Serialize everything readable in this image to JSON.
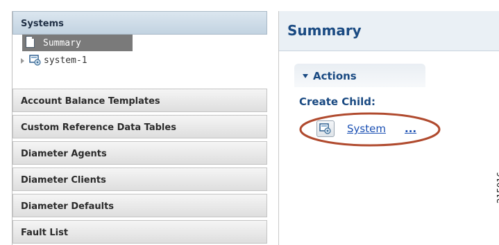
{
  "left_nav": {
    "systems_header": "Systems",
    "summary_item": "Summary",
    "tree_item": "system-1",
    "sections": [
      "Account Balance Templates",
      "Custom Reference Data Tables",
      "Diameter Agents",
      "Diameter Clients",
      "Diameter Defaults",
      "Fault List"
    ]
  },
  "right_panel": {
    "title": "Summary",
    "actions_label": "Actions",
    "create_child_label": "Create Child:",
    "system_link": "System",
    "more_link": "..."
  },
  "figure_id": "215016",
  "colors": {
    "accent": "#1a4a82",
    "link": "#1a4fb3",
    "callout": "#b04a2e",
    "selected": "#7a7a7a"
  }
}
